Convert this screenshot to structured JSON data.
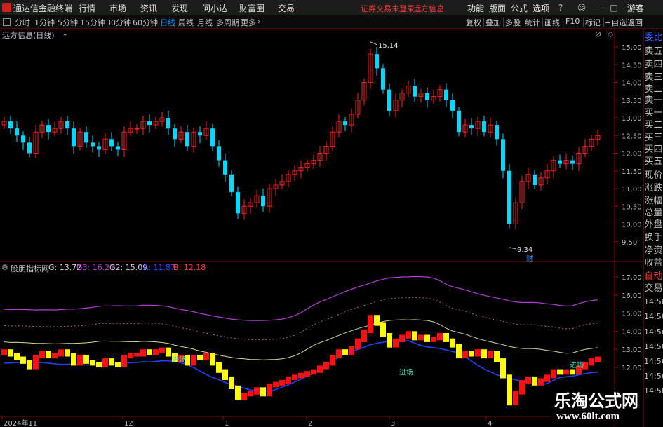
{
  "menubar": {
    "app_title": "通达信金融终端",
    "items": [
      "行情",
      "市场",
      "资讯",
      "发现",
      "问小达",
      "财富圈",
      "交易"
    ],
    "status": "证券交易未登录",
    "stock_name": "远方信息",
    "right_items": [
      "功能",
      "版面",
      "公式",
      "选项"
    ],
    "user": "游客"
  },
  "periods": {
    "items": [
      "分时",
      "1分钟",
      "5分钟",
      "15分钟",
      "30分钟",
      "60分钟",
      "日线",
      "周线",
      "月线",
      "多周期",
      "更多"
    ],
    "active": "日线"
  },
  "toolbar": {
    "items": [
      "复权",
      "叠加",
      "多股",
      "统计",
      "画线",
      "F10",
      "标记",
      "+自选",
      "返回"
    ]
  },
  "main_chart": {
    "title": "远方信息(日线)",
    "high_label": "15.14",
    "low_label": "9.34",
    "low_tag": "财",
    "price_ticks": [
      "15.00",
      "14.50",
      "14.00",
      "13.50",
      "13.00",
      "12.50",
      "12.00",
      "11.50",
      "11.00",
      "10.50",
      "10.00",
      "9.50"
    ]
  },
  "indicator": {
    "name": "股朋指标网",
    "values": [
      {
        "label": "G: 13.72",
        "color": "#d8d8d8"
      },
      {
        "label": "G3: 16.21",
        "color": "#b040d0"
      },
      {
        "label": "G2: 15.09",
        "color": "#e0c0e0"
      },
      {
        "label": "A: 11.87",
        "color": "#3050ff"
      },
      {
        "label": "B: 12.18",
        "color": "#ff4040"
      }
    ],
    "ticks": [
      "17.00",
      "16.00",
      "15.00",
      "14.00",
      "13.00",
      "12.00"
    ],
    "markers": [
      "进场",
      "进场",
      "进场"
    ]
  },
  "x_axis": {
    "labels": [
      "2024年11",
      "12",
      "1",
      "2",
      "3",
      "4"
    ]
  },
  "sidebar": {
    "items": [
      "委比",
      "卖五",
      "卖四",
      "卖三",
      "卖二",
      "卖一",
      "买一",
      "买二",
      "买三",
      "买四",
      "买五",
      "现价",
      "涨跌",
      "涨幅",
      "总量",
      "外盘",
      "换手",
      "净资",
      "收益",
      "自动",
      "交易"
    ],
    "times": [
      "14:56",
      "14:56",
      "14:56",
      "14:56",
      "14:56",
      "14:56",
      "14:56"
    ]
  },
  "watermark": {
    "cn": "乐淘公式网",
    "url": "www.60lt.com"
  },
  "colors": {
    "up": "#ff2020",
    "down": "#00d8ff",
    "ind_up": "#ff1010",
    "ind_down": "#ffff00"
  }
}
